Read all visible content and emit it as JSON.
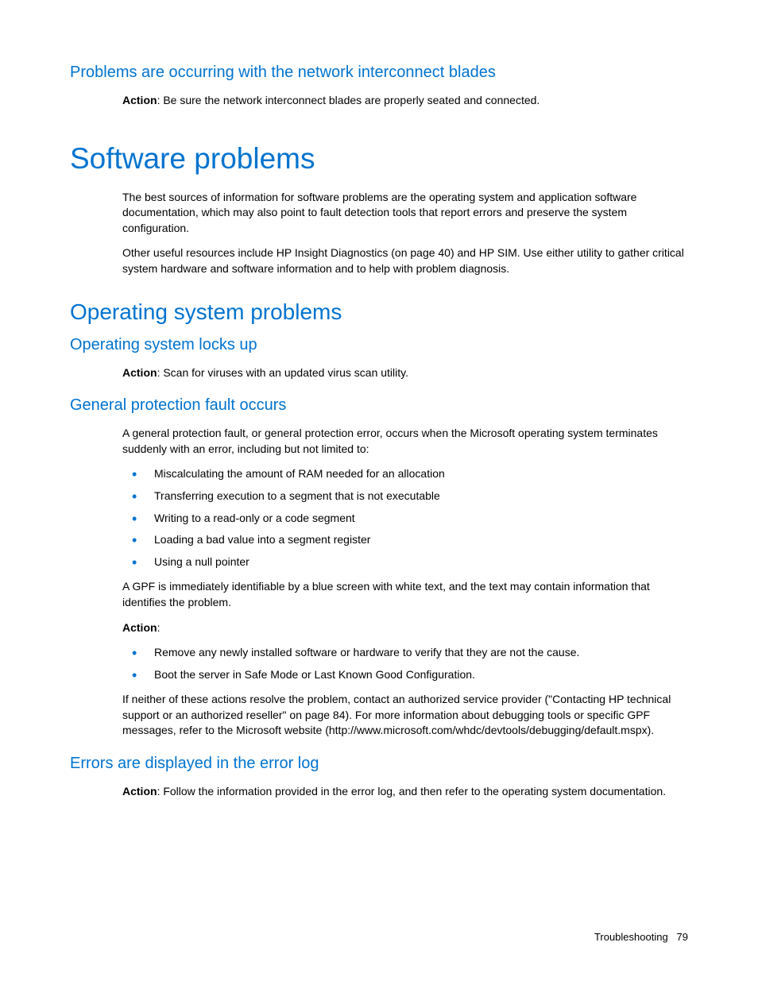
{
  "sec1": {
    "heading": "Problems are occurring with the network interconnect blades",
    "action_label": "Action",
    "action_text": ": Be sure the network interconnect blades are properly seated and connected."
  },
  "sec2": {
    "heading": "Software problems",
    "p1": "The best sources of information for software problems are the operating system and application software documentation, which may also point to fault detection tools that report errors and preserve the system configuration.",
    "p2": "Other useful resources include HP Insight Diagnostics (on page 40) and HP SIM. Use either utility to gather critical system hardware and software information and to help with problem diagnosis."
  },
  "sec3": {
    "heading": "Operating system problems"
  },
  "sec4": {
    "heading": "Operating system locks up",
    "action_label": "Action",
    "action_text": ": Scan for viruses with an updated virus scan utility."
  },
  "sec5": {
    "heading": "General protection fault occurs",
    "p1": "A general protection fault, or general protection error, occurs when the Microsoft operating system terminates suddenly with an error, including but not limited to:",
    "bullets1": [
      "Miscalculating the amount of RAM needed for an allocation",
      "Transferring execution to a segment that is not executable",
      "Writing to a read-only or a code segment",
      "Loading a bad value into a segment register",
      "Using a null pointer"
    ],
    "p2": "A GPF is immediately identifiable by a blue screen with white text, and the text may contain information that identifies the problem.",
    "action_label": "Action",
    "action_colon": ":",
    "bullets2": [
      "Remove any newly installed software or hardware to verify that they are not the cause.",
      "Boot the server in Safe Mode or Last Known Good Configuration."
    ],
    "p3": "If neither of these actions resolve the problem, contact an authorized service provider (\"Contacting HP technical support or an authorized reseller\" on page 84). For more information about debugging tools or specific GPF messages, refer to the Microsoft website (http://www.microsoft.com/whdc/devtools/debugging/default.mspx)."
  },
  "sec6": {
    "heading": "Errors are displayed in the error log",
    "action_label": "Action",
    "action_text": ": Follow the information provided in the error log, and then refer to the operating system documentation."
  },
  "footer": {
    "section": "Troubleshooting",
    "page": "79"
  }
}
